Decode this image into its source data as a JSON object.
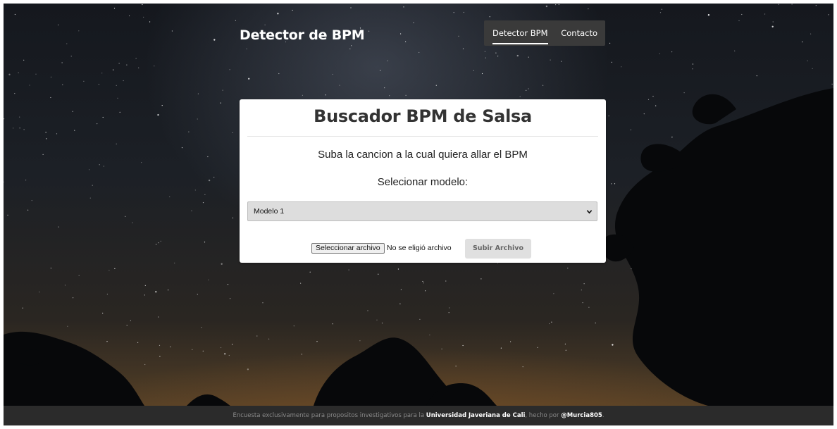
{
  "header": {
    "brand": "Detector de BPM",
    "nav": [
      {
        "label": "Detector BPM",
        "active": true
      },
      {
        "label": "Contacto",
        "active": false
      }
    ]
  },
  "card": {
    "title": "Buscador BPM de Salsa",
    "subtitle": "Suba la cancion a la cual quiera allar el BPM",
    "model_label": "Selecionar modelo:",
    "model_select": {
      "selected": "Modelo 1"
    },
    "file_button": "Seleccionar archivo",
    "file_status": "No se eligió archivo",
    "upload_button": "Subir Archivo"
  },
  "footer": {
    "text_before": "Encuesta exclusivamente para propositos investigativos para la ",
    "university": "Universidad Javeriana de Cali",
    "text_middle": ", hecho por ",
    "author": "@Murcia805",
    "text_after": "."
  },
  "colors": {
    "nav_bg": "#3a3a3a",
    "footer_bg": "#2b2b2b",
    "card_bg": "#ffffff",
    "select_bg": "#dddddd",
    "upload_bg": "#e0e0e0"
  }
}
